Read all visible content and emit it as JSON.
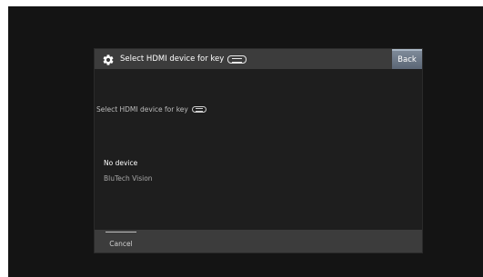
{
  "dialog": {
    "title": "Select HDMI device for key",
    "back_label": "Back",
    "prompt": "Select HDMI device for key",
    "devices": [
      {
        "label": "No device",
        "selected": true
      },
      {
        "label": "BluTech Vision",
        "selected": false
      }
    ],
    "cancel_label": "Cancel"
  },
  "icons": {
    "settings": "gear-icon",
    "key": "remote-key-icon"
  },
  "colors": {
    "screen_background": "#141414",
    "dialog_background": "#1e1e1e",
    "bar_background": "#3c3c3c",
    "back_button": "#6a7584"
  }
}
